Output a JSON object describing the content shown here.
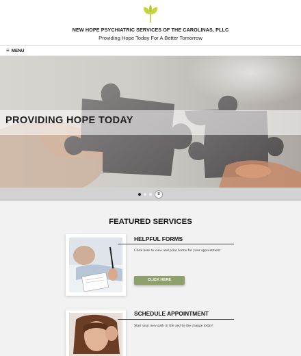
{
  "header": {
    "title": "NEW HOPE PSYCHIATRIC SERVICES OF THE CAROLINAS, PLLC",
    "tagline": "Providing Hope Today For A Better Tomorrow",
    "logo_icon": "sprout-icon",
    "accent_color": "#c7d43f"
  },
  "menu": {
    "icon": "hamburger-icon",
    "label": "MENU"
  },
  "hero": {
    "title": "PROVIDING HOPE TODAY",
    "slide_count": 3,
    "active_slide": 1,
    "pause_icon": "pause-icon"
  },
  "featured": {
    "title": "FEATURED SERVICES",
    "items": [
      {
        "heading": "HELPFUL FORMS",
        "text": "Click here to view and print forms for your appointment",
        "button_label": "CLICK HERE",
        "button_color": "#8ea06c"
      },
      {
        "heading": "SCHEDULE APPOINTMENT",
        "text": "Start your new path in life and be the change today!"
      }
    ]
  }
}
